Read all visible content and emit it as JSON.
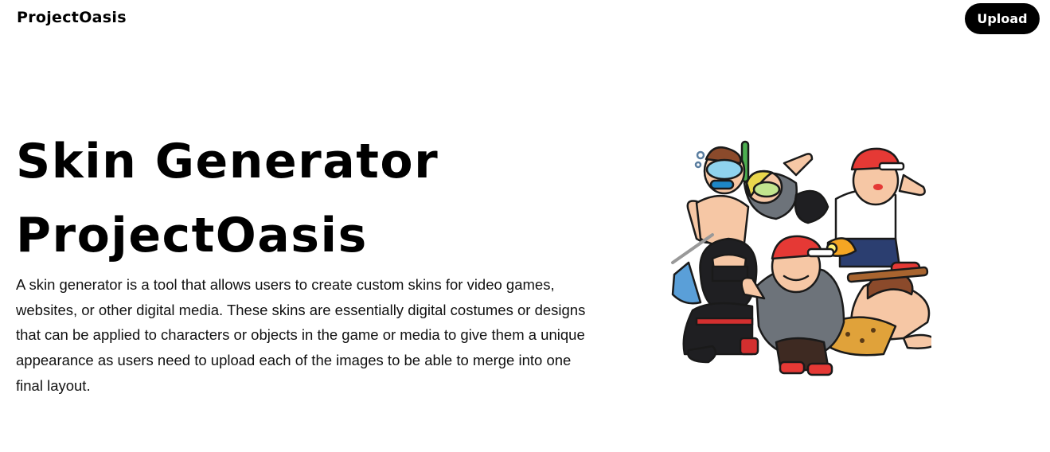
{
  "header": {
    "brand": "ProjectOasis",
    "upload_label": "Upload"
  },
  "hero": {
    "title_line1": "Skin Generator",
    "title_line2": "ProjectOasis",
    "description": "A skin generator is a tool that allows users to create custom skins for video games, websites, or other digital media. These skins are essentially digital costumes or designs that can be applied to characters or objects in the game or media to give them a unique appearance as users need to upload each of the images to be able to merge into one final layout."
  },
  "illustration": {
    "icon": "cartoon-characters-group"
  },
  "colors": {
    "background": "#ffffff",
    "text": "#000000",
    "button_bg": "#000000",
    "button_text": "#ffffff"
  }
}
